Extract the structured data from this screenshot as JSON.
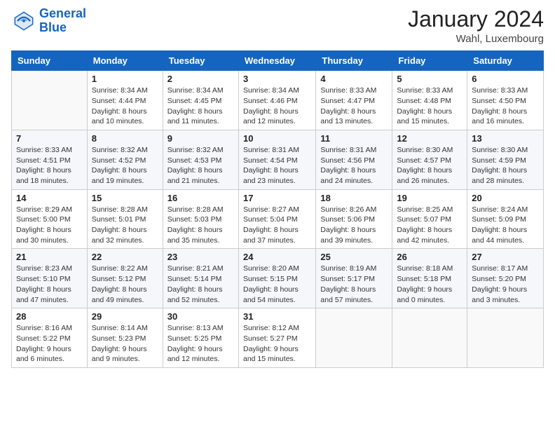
{
  "header": {
    "logo_line1": "General",
    "logo_line2": "Blue",
    "month": "January 2024",
    "location": "Wahl, Luxembourg"
  },
  "weekdays": [
    "Sunday",
    "Monday",
    "Tuesday",
    "Wednesday",
    "Thursday",
    "Friday",
    "Saturday"
  ],
  "weeks": [
    [
      {
        "day": "",
        "sunrise": "",
        "sunset": "",
        "daylight": ""
      },
      {
        "day": "1",
        "sunrise": "Sunrise: 8:34 AM",
        "sunset": "Sunset: 4:44 PM",
        "daylight": "Daylight: 8 hours and 10 minutes."
      },
      {
        "day": "2",
        "sunrise": "Sunrise: 8:34 AM",
        "sunset": "Sunset: 4:45 PM",
        "daylight": "Daylight: 8 hours and 11 minutes."
      },
      {
        "day": "3",
        "sunrise": "Sunrise: 8:34 AM",
        "sunset": "Sunset: 4:46 PM",
        "daylight": "Daylight: 8 hours and 12 minutes."
      },
      {
        "day": "4",
        "sunrise": "Sunrise: 8:33 AM",
        "sunset": "Sunset: 4:47 PM",
        "daylight": "Daylight: 8 hours and 13 minutes."
      },
      {
        "day": "5",
        "sunrise": "Sunrise: 8:33 AM",
        "sunset": "Sunset: 4:48 PM",
        "daylight": "Daylight: 8 hours and 15 minutes."
      },
      {
        "day": "6",
        "sunrise": "Sunrise: 8:33 AM",
        "sunset": "Sunset: 4:50 PM",
        "daylight": "Daylight: 8 hours and 16 minutes."
      }
    ],
    [
      {
        "day": "7",
        "sunrise": "Sunrise: 8:33 AM",
        "sunset": "Sunset: 4:51 PM",
        "daylight": "Daylight: 8 hours and 18 minutes."
      },
      {
        "day": "8",
        "sunrise": "Sunrise: 8:32 AM",
        "sunset": "Sunset: 4:52 PM",
        "daylight": "Daylight: 8 hours and 19 minutes."
      },
      {
        "day": "9",
        "sunrise": "Sunrise: 8:32 AM",
        "sunset": "Sunset: 4:53 PM",
        "daylight": "Daylight: 8 hours and 21 minutes."
      },
      {
        "day": "10",
        "sunrise": "Sunrise: 8:31 AM",
        "sunset": "Sunset: 4:54 PM",
        "daylight": "Daylight: 8 hours and 23 minutes."
      },
      {
        "day": "11",
        "sunrise": "Sunrise: 8:31 AM",
        "sunset": "Sunset: 4:56 PM",
        "daylight": "Daylight: 8 hours and 24 minutes."
      },
      {
        "day": "12",
        "sunrise": "Sunrise: 8:30 AM",
        "sunset": "Sunset: 4:57 PM",
        "daylight": "Daylight: 8 hours and 26 minutes."
      },
      {
        "day": "13",
        "sunrise": "Sunrise: 8:30 AM",
        "sunset": "Sunset: 4:59 PM",
        "daylight": "Daylight: 8 hours and 28 minutes."
      }
    ],
    [
      {
        "day": "14",
        "sunrise": "Sunrise: 8:29 AM",
        "sunset": "Sunset: 5:00 PM",
        "daylight": "Daylight: 8 hours and 30 minutes."
      },
      {
        "day": "15",
        "sunrise": "Sunrise: 8:28 AM",
        "sunset": "Sunset: 5:01 PM",
        "daylight": "Daylight: 8 hours and 32 minutes."
      },
      {
        "day": "16",
        "sunrise": "Sunrise: 8:28 AM",
        "sunset": "Sunset: 5:03 PM",
        "daylight": "Daylight: 8 hours and 35 minutes."
      },
      {
        "day": "17",
        "sunrise": "Sunrise: 8:27 AM",
        "sunset": "Sunset: 5:04 PM",
        "daylight": "Daylight: 8 hours and 37 minutes."
      },
      {
        "day": "18",
        "sunrise": "Sunrise: 8:26 AM",
        "sunset": "Sunset: 5:06 PM",
        "daylight": "Daylight: 8 hours and 39 minutes."
      },
      {
        "day": "19",
        "sunrise": "Sunrise: 8:25 AM",
        "sunset": "Sunset: 5:07 PM",
        "daylight": "Daylight: 8 hours and 42 minutes."
      },
      {
        "day": "20",
        "sunrise": "Sunrise: 8:24 AM",
        "sunset": "Sunset: 5:09 PM",
        "daylight": "Daylight: 8 hours and 44 minutes."
      }
    ],
    [
      {
        "day": "21",
        "sunrise": "Sunrise: 8:23 AM",
        "sunset": "Sunset: 5:10 PM",
        "daylight": "Daylight: 8 hours and 47 minutes."
      },
      {
        "day": "22",
        "sunrise": "Sunrise: 8:22 AM",
        "sunset": "Sunset: 5:12 PM",
        "daylight": "Daylight: 8 hours and 49 minutes."
      },
      {
        "day": "23",
        "sunrise": "Sunrise: 8:21 AM",
        "sunset": "Sunset: 5:14 PM",
        "daylight": "Daylight: 8 hours and 52 minutes."
      },
      {
        "day": "24",
        "sunrise": "Sunrise: 8:20 AM",
        "sunset": "Sunset: 5:15 PM",
        "daylight": "Daylight: 8 hours and 54 minutes."
      },
      {
        "day": "25",
        "sunrise": "Sunrise: 8:19 AM",
        "sunset": "Sunset: 5:17 PM",
        "daylight": "Daylight: 8 hours and 57 minutes."
      },
      {
        "day": "26",
        "sunrise": "Sunrise: 8:18 AM",
        "sunset": "Sunset: 5:18 PM",
        "daylight": "Daylight: 9 hours and 0 minutes."
      },
      {
        "day": "27",
        "sunrise": "Sunrise: 8:17 AM",
        "sunset": "Sunset: 5:20 PM",
        "daylight": "Daylight: 9 hours and 3 minutes."
      }
    ],
    [
      {
        "day": "28",
        "sunrise": "Sunrise: 8:16 AM",
        "sunset": "Sunset: 5:22 PM",
        "daylight": "Daylight: 9 hours and 6 minutes."
      },
      {
        "day": "29",
        "sunrise": "Sunrise: 8:14 AM",
        "sunset": "Sunset: 5:23 PM",
        "daylight": "Daylight: 9 hours and 9 minutes."
      },
      {
        "day": "30",
        "sunrise": "Sunrise: 8:13 AM",
        "sunset": "Sunset: 5:25 PM",
        "daylight": "Daylight: 9 hours and 12 minutes."
      },
      {
        "day": "31",
        "sunrise": "Sunrise: 8:12 AM",
        "sunset": "Sunset: 5:27 PM",
        "daylight": "Daylight: 9 hours and 15 minutes."
      },
      {
        "day": "",
        "sunrise": "",
        "sunset": "",
        "daylight": ""
      },
      {
        "day": "",
        "sunrise": "",
        "sunset": "",
        "daylight": ""
      },
      {
        "day": "",
        "sunrise": "",
        "sunset": "",
        "daylight": ""
      }
    ]
  ]
}
